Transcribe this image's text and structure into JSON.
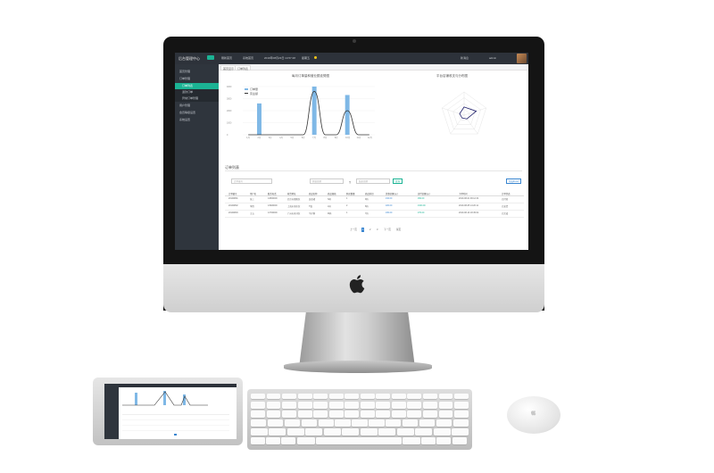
{
  "colors": {
    "accent": "#1bb394",
    "blue": "#3a86d0",
    "sidebar": "#2f353d",
    "topbar": "#2d323a"
  },
  "app": {
    "title": "后台管理中心",
    "topbar_items": [
      "刷新首页",
      "系统首页",
      "2019年08月23日 14:57:48",
      "星期五"
    ],
    "status": "新消息",
    "user": "admin"
  },
  "sidebar": {
    "items": [
      {
        "label": "首页管理",
        "sub": false,
        "active": false
      },
      {
        "label": "订单管理",
        "sub": false,
        "active": false
      },
      {
        "label": "订单列表",
        "sub": true,
        "active": true
      },
      {
        "label": "退款订单",
        "sub": true,
        "active": false
      },
      {
        "label": "异常订单管理",
        "sub": true,
        "active": false
      },
      {
        "label": "用户管理",
        "sub": false,
        "active": false
      },
      {
        "label": "会员等级设置",
        "sub": false,
        "active": false
      },
      {
        "label": "系统设置",
        "sub": false,
        "active": false
      }
    ]
  },
  "tabs": [
    {
      "label": "首页显示"
    },
    {
      "label": "订单列表"
    }
  ],
  "charts": {
    "left_title": "每月订单量和营业额走势图",
    "right_title": "平台店铺收支与分布图",
    "legend": [
      "订单量",
      "营业额"
    ]
  },
  "chart_data": [
    {
      "type": "bar",
      "title": "每月订单量和营业额走势图",
      "categories": [
        "1月",
        "2月",
        "3月",
        "4月",
        "5月",
        "6月",
        "7月",
        "8月",
        "9月",
        "10月",
        "11月",
        "12月"
      ],
      "series": [
        {
          "name": "订单量",
          "values": [
            0,
            2600,
            0,
            0,
            0,
            0,
            4000,
            0,
            0,
            3300,
            0,
            0
          ]
        },
        {
          "name": "营业额",
          "values": [
            0,
            0,
            0,
            0,
            0,
            0,
            3600,
            0,
            0,
            2000,
            0,
            0
          ]
        }
      ],
      "ylim": [
        0,
        4000
      ],
      "legend": "top-left"
    },
    {
      "type": "radar",
      "title": "平台店铺收支与分布图",
      "indicators": [
        "A",
        "B",
        "C",
        "D",
        "E"
      ],
      "series": [
        {
          "values": [
            0.35,
            0.55,
            0.2,
            0.15,
            0.2
          ]
        }
      ]
    }
  ],
  "order_list": {
    "title": "订单列表",
    "filters": {
      "keyword_placeholder": "订单编号",
      "start_placeholder": "开始日期",
      "separator": "至",
      "end_placeholder": "结束日期",
      "search_label": "查询",
      "export_label": "导出Excel"
    },
    "columns": [
      "订单编号",
      "用户名",
      "联系电话",
      "收货地址",
      "商品名称",
      "商品规格",
      "购买数量",
      "商品折扣",
      "优惠金额(元)",
      "实付金额(元)",
      "下单时间",
      "订单状态"
    ],
    "rows": [
      [
        "20190801",
        "张三",
        "13800000",
        "北京市朝阳区",
        "连衣裙",
        "S码",
        "1",
        "9折",
        "¥10.00",
        "¥90.00",
        "2019-08-01 09:12:34",
        "已付款"
      ],
      [
        "20190802",
        "李四",
        "13900000",
        "上海市浦东区",
        "T恤",
        "L码",
        "2",
        "8折",
        "¥20.00",
        "¥160.00",
        "2019-08-05 14:20:11",
        "已发货"
      ],
      [
        "20190803",
        "王五",
        "13700000",
        "广州市天河区",
        "牛仔裤",
        "M码",
        "1",
        "7折",
        "¥30.00",
        "¥70.00",
        "2019-08-10 18:45:02",
        "已完成"
      ]
    ],
    "pagination": {
      "prev": "上一页",
      "pages": [
        "1",
        "2",
        "3"
      ],
      "next": "下一页",
      "last": "尾页",
      "current": "1"
    }
  }
}
